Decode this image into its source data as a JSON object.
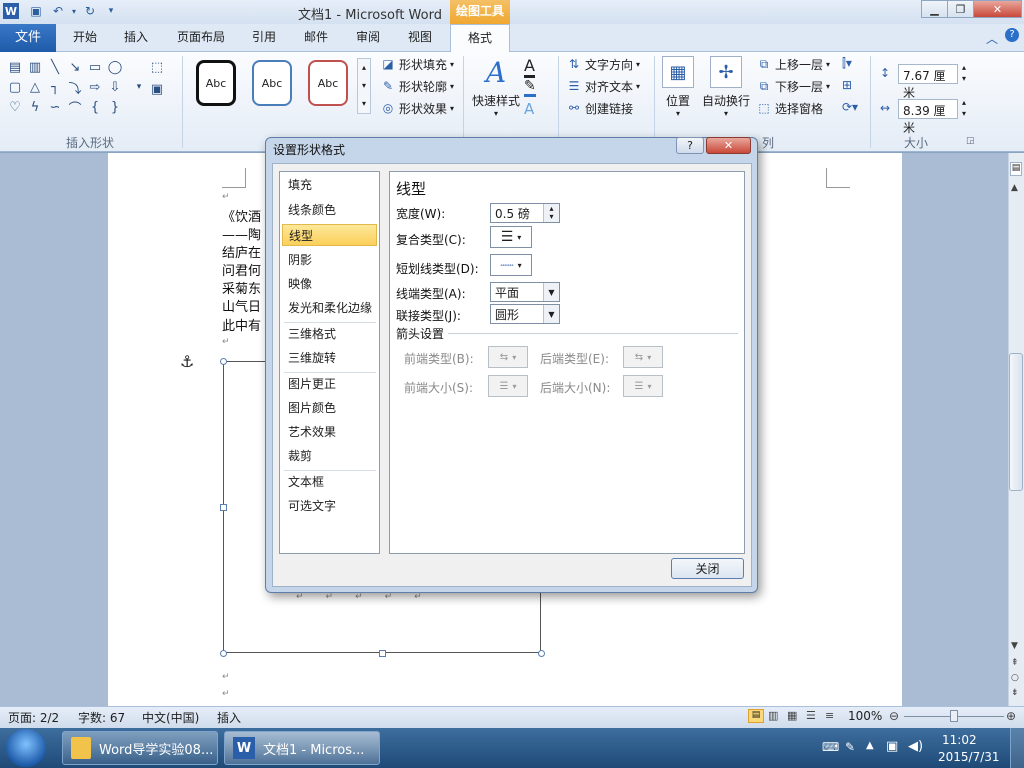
{
  "window": {
    "title": "文档1 - Microsoft Word",
    "contextual_tab_group": "绘图工具"
  },
  "ribbon_tabs": [
    "文件",
    "开始",
    "插入",
    "页面布局",
    "引用",
    "邮件",
    "审阅",
    "视图",
    "格式"
  ],
  "ribbon": {
    "insert_shapes_label": "插入形状",
    "style_samples": [
      "Abc",
      "Abc",
      "Abc"
    ],
    "shape_fill": "形状填充",
    "shape_outline": "形状轮廓",
    "shape_effects": "形状效果",
    "quick_styles": "快速样式",
    "text_direction": "文字方向",
    "align_text": "对齐文本",
    "create_link": "创建链接",
    "position": "位置",
    "wrap_text": "自动换行",
    "bring_forward": "上移一层",
    "send_backward": "下移一层",
    "selection_pane": "选择窗格",
    "arrange_label": "列",
    "height_value": "7.67 厘米",
    "width_value": "8.39 厘米",
    "size_label": "大小"
  },
  "document": {
    "lines": [
      "《饮酒",
      "——陶",
      "结庐在",
      "问君何",
      "采菊东",
      "山气日",
      "此中有"
    ]
  },
  "dialog": {
    "title": "设置形状格式",
    "categories": [
      "填充",
      "线条颜色",
      "线型",
      "阴影",
      "映像",
      "发光和柔化边缘",
      "三维格式",
      "三维旋转",
      "图片更正",
      "图片颜色",
      "艺术效果",
      "裁剪",
      "文本框",
      "可选文字"
    ],
    "selected_category": "线型",
    "panel_title": "线型",
    "width_label": "宽度(W):",
    "width_value": "0.5 磅",
    "compound_label": "复合类型(C):",
    "dash_label": "短划线类型(D):",
    "cap_label": "线端类型(A):",
    "cap_value": "平面",
    "join_label": "联接类型(J):",
    "join_value": "圆形",
    "arrow_section": "箭头设置",
    "begin_type_label": "前端类型(B):",
    "end_type_label": "后端类型(E):",
    "begin_size_label": "前端大小(S):",
    "end_size_label": "后端大小(N):",
    "close_button": "关闭"
  },
  "statusbar": {
    "page": "页面: 2/2",
    "words": "字数: 67",
    "language": "中文(中国)",
    "mode": "插入",
    "zoom": "100%"
  },
  "taskbar": {
    "items": [
      "Word导学实验08...",
      "文档1 - Micros..."
    ],
    "time": "11:02",
    "date": "2015/7/31"
  }
}
